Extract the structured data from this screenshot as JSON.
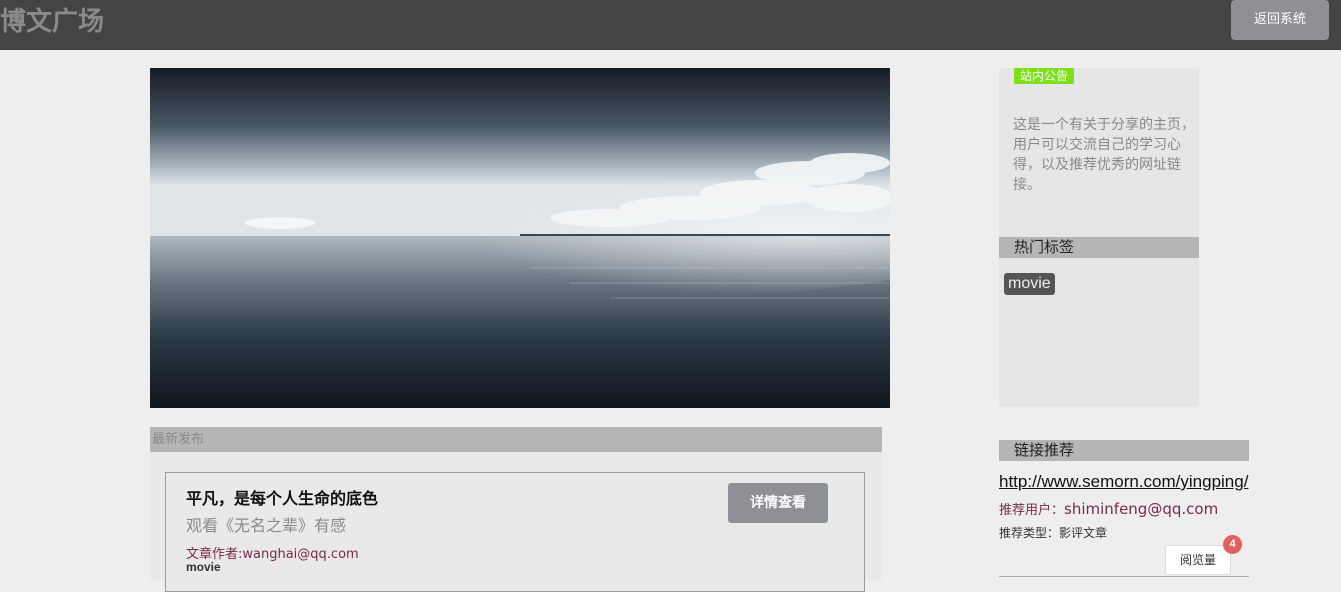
{
  "header": {
    "site_title": "博文广场",
    "back_button": "返回系统"
  },
  "hero": {
    "image": "seascape-clouds"
  },
  "latest": {
    "section_title": "最新发布",
    "articles": [
      {
        "title": "平凡，是每个人生命的底色",
        "subtitle": "观看《无名之辈》有感",
        "author_label": "文章作者:",
        "author": "wanghai@qq.com",
        "tag": "movie",
        "detail_button": "详情查看"
      }
    ]
  },
  "sidebar": {
    "notice_label": "站内公告",
    "notice_text": "这是一个有关于分享的主页，用户可以交流自己的学习心得，以及推荐优秀的网址链接。",
    "hot_tags_title": "热门标签",
    "hot_tags": [
      "movie"
    ],
    "links_title": "链接推荐",
    "links": [
      {
        "url": "http://www.semorn.com/yingping/",
        "user_label": "推荐用户：",
        "user": "shiminfeng@qq.com",
        "type_label": "推荐类型：",
        "type": "影评文章",
        "views_label": "阅览量",
        "views_count": "4"
      }
    ]
  },
  "colors": {
    "topbar": "#444444",
    "button": "#8e9096",
    "notice_accent": "#7ee01a",
    "badge": "#e06060"
  }
}
